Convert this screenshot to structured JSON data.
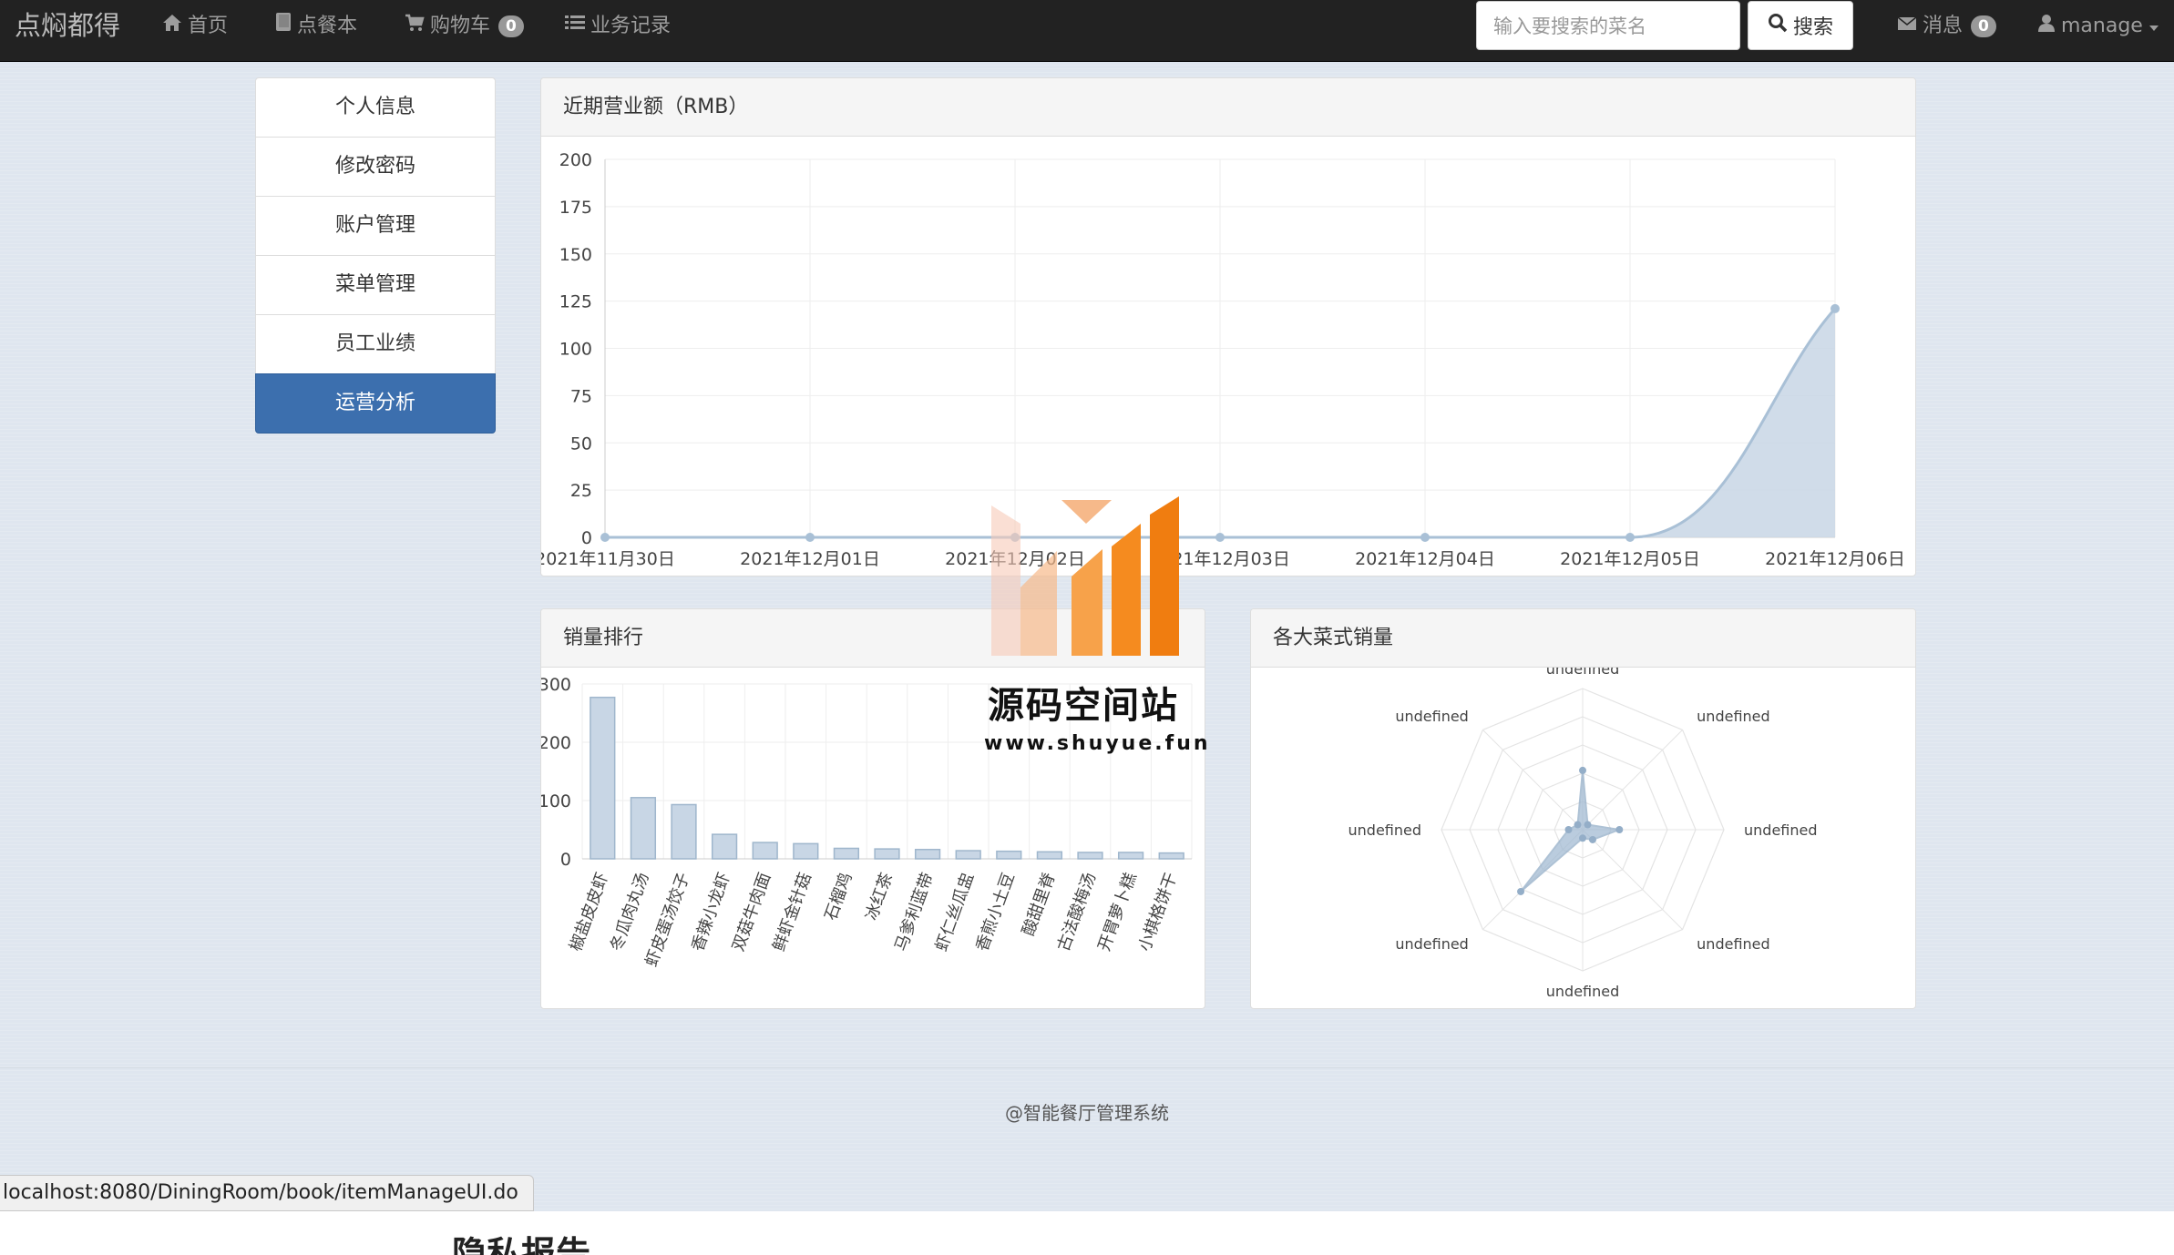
{
  "navbar": {
    "brand": "点焖都得",
    "home": "首页",
    "menu_book": "点餐本",
    "cart": "购物车",
    "cart_count": "0",
    "records": "业务记录",
    "search_placeholder": "输入要搜索的菜名",
    "search_button": "搜索",
    "messages": "消息",
    "messages_count": "0",
    "user": "manage"
  },
  "sidebar": {
    "items": [
      {
        "label": "个人信息"
      },
      {
        "label": "修改密码"
      },
      {
        "label": "账户管理"
      },
      {
        "label": "菜单管理"
      },
      {
        "label": "员工业绩"
      },
      {
        "label": "运营分析"
      }
    ]
  },
  "revenue_panel": {
    "title": "近期营业额（RMB）"
  },
  "sales_rank_panel": {
    "title": "销量排行"
  },
  "category_panel": {
    "title": "各大菜式销量"
  },
  "chart_data": [
    {
      "type": "area",
      "title": "近期营业额（RMB）",
      "x": [
        "2021年11月30日",
        "2021年12月01日",
        "2021年12月02日",
        "2021年12月03日",
        "2021年12月04日",
        "2021年12月05日",
        "2021年12月06日"
      ],
      "values": [
        0,
        0,
        0,
        0,
        0,
        0,
        121
      ],
      "ylim": [
        0,
        200
      ],
      "yticks": [
        0,
        25,
        50,
        75,
        100,
        125,
        150,
        175,
        200
      ],
      "grid": true,
      "color": "#c8d6e5"
    },
    {
      "type": "bar",
      "title": "销量排行",
      "categories": [
        "椒盐皮皮虾",
        "冬瓜肉丸汤",
        "虾皮蛋汤饺子",
        "香辣小龙虾",
        "双菇牛肉面",
        "鲜虾金针菇",
        "石榴鸡",
        "冰红茶",
        "马爹利蓝带",
        "虾仁丝瓜盅",
        "香煎小土豆",
        "酸甜里脊",
        "古法酸梅汤",
        "开胃萝卜糕",
        "小棋格饼干"
      ],
      "values": [
        277,
        105,
        93,
        42,
        28,
        26,
        18,
        17,
        16,
        14,
        13,
        12,
        11,
        11,
        10
      ],
      "ylim": [
        0,
        300
      ],
      "yticks": [
        0,
        100,
        200,
        300
      ],
      "grid": true,
      "color": "#c8d6e5"
    },
    {
      "type": "radar",
      "title": "各大菜式销量",
      "axes": [
        "undefined",
        "undefined",
        "undefined",
        "undefined",
        "undefined",
        "undefined",
        "undefined",
        "undefined"
      ],
      "values": [
        0.42,
        0.05,
        0.26,
        0.1,
        0.06,
        0.62,
        0.1,
        0.05
      ],
      "color": "#a3bbd3"
    }
  ],
  "footer": {
    "text": "@智能餐厅管理系统"
  },
  "status_bar": {
    "url": "localhost:8080/DiningRoom/book/itemManageUI.do"
  },
  "below_fold": {
    "title": "隐私报告"
  },
  "watermark": {
    "title": "源码空间站",
    "url": "www.shuyue.fun"
  }
}
